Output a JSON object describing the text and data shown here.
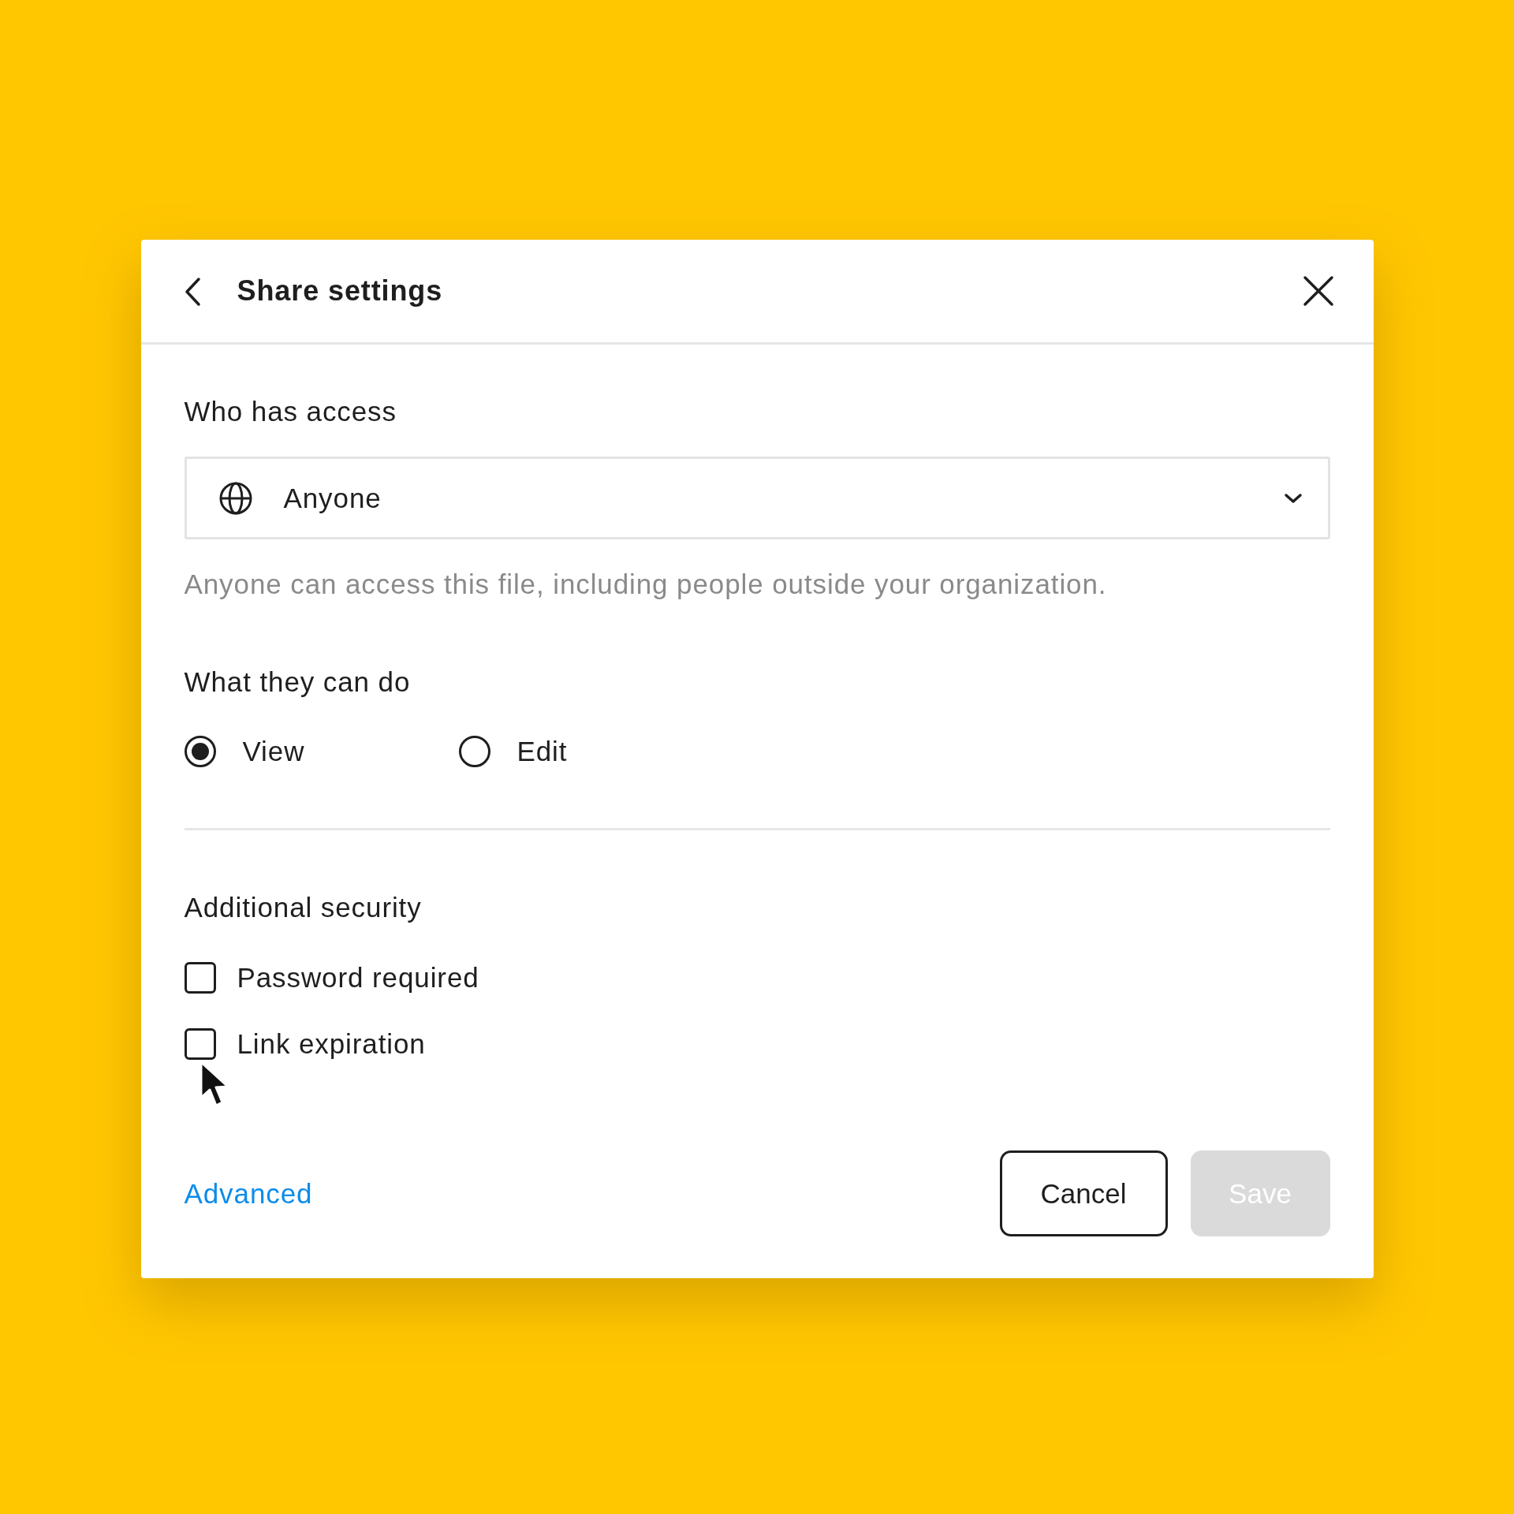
{
  "dialog": {
    "title": "Share settings",
    "access": {
      "heading": "Who has access",
      "dropdown": {
        "value": "Anyone"
      },
      "description": "Anyone can access this file, including people outside your organization."
    },
    "permissions": {
      "heading": "What they can do",
      "options": [
        {
          "label": "View",
          "selected": true
        },
        {
          "label": "Edit",
          "selected": false
        }
      ]
    },
    "security": {
      "heading": "Additional security",
      "options": [
        {
          "label": "Password required",
          "checked": false
        },
        {
          "label": "Link expiration",
          "checked": false
        }
      ]
    },
    "advanced_link": "Advanced",
    "buttons": [
      {
        "label": "Cancel",
        "kind": "secondary",
        "disabled": false
      },
      {
        "label": "Save",
        "kind": "primary",
        "disabled": true
      }
    ]
  }
}
